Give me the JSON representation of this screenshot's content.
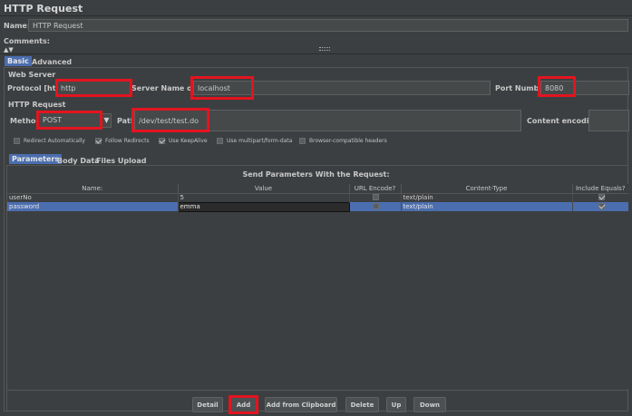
{
  "header": {
    "title": "HTTP Request"
  },
  "name": {
    "label": "Name:",
    "value": "HTTP Request"
  },
  "comments": {
    "label": "Comments:"
  },
  "main_tabs": [
    {
      "label": "Basic"
    },
    {
      "label": "Advanced"
    }
  ],
  "web_server": {
    "heading": "Web Server",
    "protocol_label": "Protocol [http]:",
    "protocol_value": "http",
    "server_label": "Server Name or IP:",
    "server_value": "localhost",
    "port_label": "Port Number:",
    "port_value": "8080"
  },
  "http_request": {
    "heading": "HTTP Request",
    "method_label": "Method:",
    "method_value": "POST",
    "path_label": "Path:",
    "path_value": "/dev/test/test.do",
    "encoding_label": "Content encoding:",
    "encoding_value": ""
  },
  "options": [
    {
      "label": "Redirect Automatically",
      "checked": false
    },
    {
      "label": "Follow Redirects",
      "checked": true
    },
    {
      "label": "Use KeepAlive",
      "checked": true
    },
    {
      "label": "Use multipart/form-data",
      "checked": false
    },
    {
      "label": "Browser-compatible headers",
      "checked": false
    }
  ],
  "param_tabs": [
    {
      "label": "Parameters"
    },
    {
      "label": "Body Data"
    },
    {
      "label": "Files Upload"
    }
  ],
  "params": {
    "title": "Send Parameters With the Request:",
    "columns": [
      "Name:",
      "Value",
      "URL Encode?",
      "Content-Type",
      "Include Equals?"
    ],
    "rows": [
      {
        "name": "userNo",
        "value": "5",
        "encode": false,
        "type": "text/plain",
        "equals": true
      },
      {
        "name": "password",
        "value": "emma",
        "encode": false,
        "type": "text/plain",
        "equals": true
      }
    ]
  },
  "buttons": {
    "detail": "Detail",
    "add": "Add",
    "add_clipboard": "Add from Clipboard",
    "delete": "Delete",
    "up": "Up",
    "down": "Down"
  },
  "colors": {
    "highlight": "#e3141f",
    "selection": "#4b6eaf",
    "background": "#3c3f41"
  }
}
